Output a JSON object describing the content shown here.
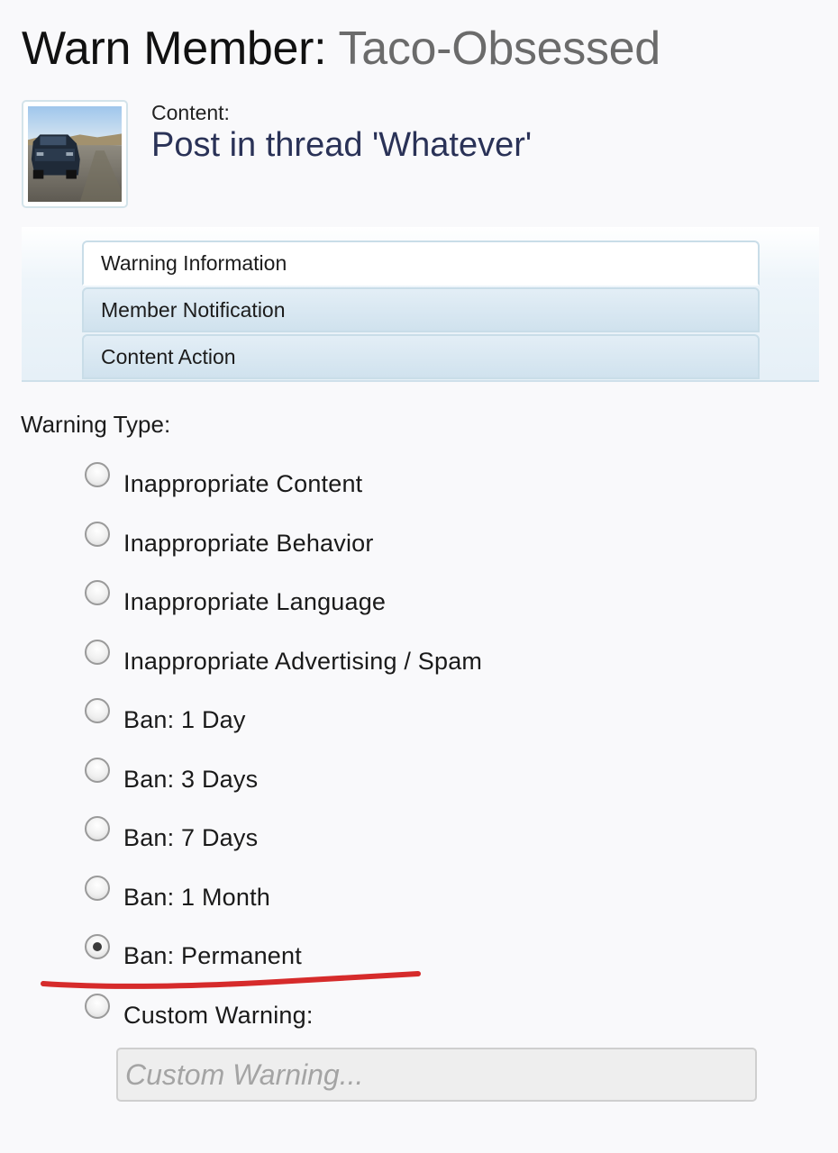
{
  "header": {
    "title_prefix": "Warn Member:",
    "member_name": "Taco-Obsessed"
  },
  "content": {
    "label": "Content:",
    "link_text": "Post in thread 'Whatever'"
  },
  "tabs": [
    {
      "label": "Warning Information",
      "active": true
    },
    {
      "label": "Member Notification",
      "active": false
    },
    {
      "label": "Content Action",
      "active": false
    }
  ],
  "warning_type": {
    "label": "Warning Type:",
    "options": [
      {
        "label": "Inappropriate Content",
        "checked": false
      },
      {
        "label": "Inappropriate Behavior",
        "checked": false
      },
      {
        "label": "Inappropriate Language",
        "checked": false
      },
      {
        "label": "Inappropriate Advertising / Spam",
        "checked": false
      },
      {
        "label": "Ban: 1 Day",
        "checked": false
      },
      {
        "label": "Ban: 3 Days",
        "checked": false
      },
      {
        "label": "Ban: 7 Days",
        "checked": false
      },
      {
        "label": "Ban: 1 Month",
        "checked": false
      },
      {
        "label": "Ban: Permanent",
        "checked": true
      },
      {
        "label": "Custom Warning:",
        "checked": false
      }
    ],
    "selected": "Ban: Permanent",
    "custom_input": {
      "value": "",
      "placeholder": "Custom Warning..."
    }
  },
  "annotation": {
    "color": "#d62b2b"
  }
}
